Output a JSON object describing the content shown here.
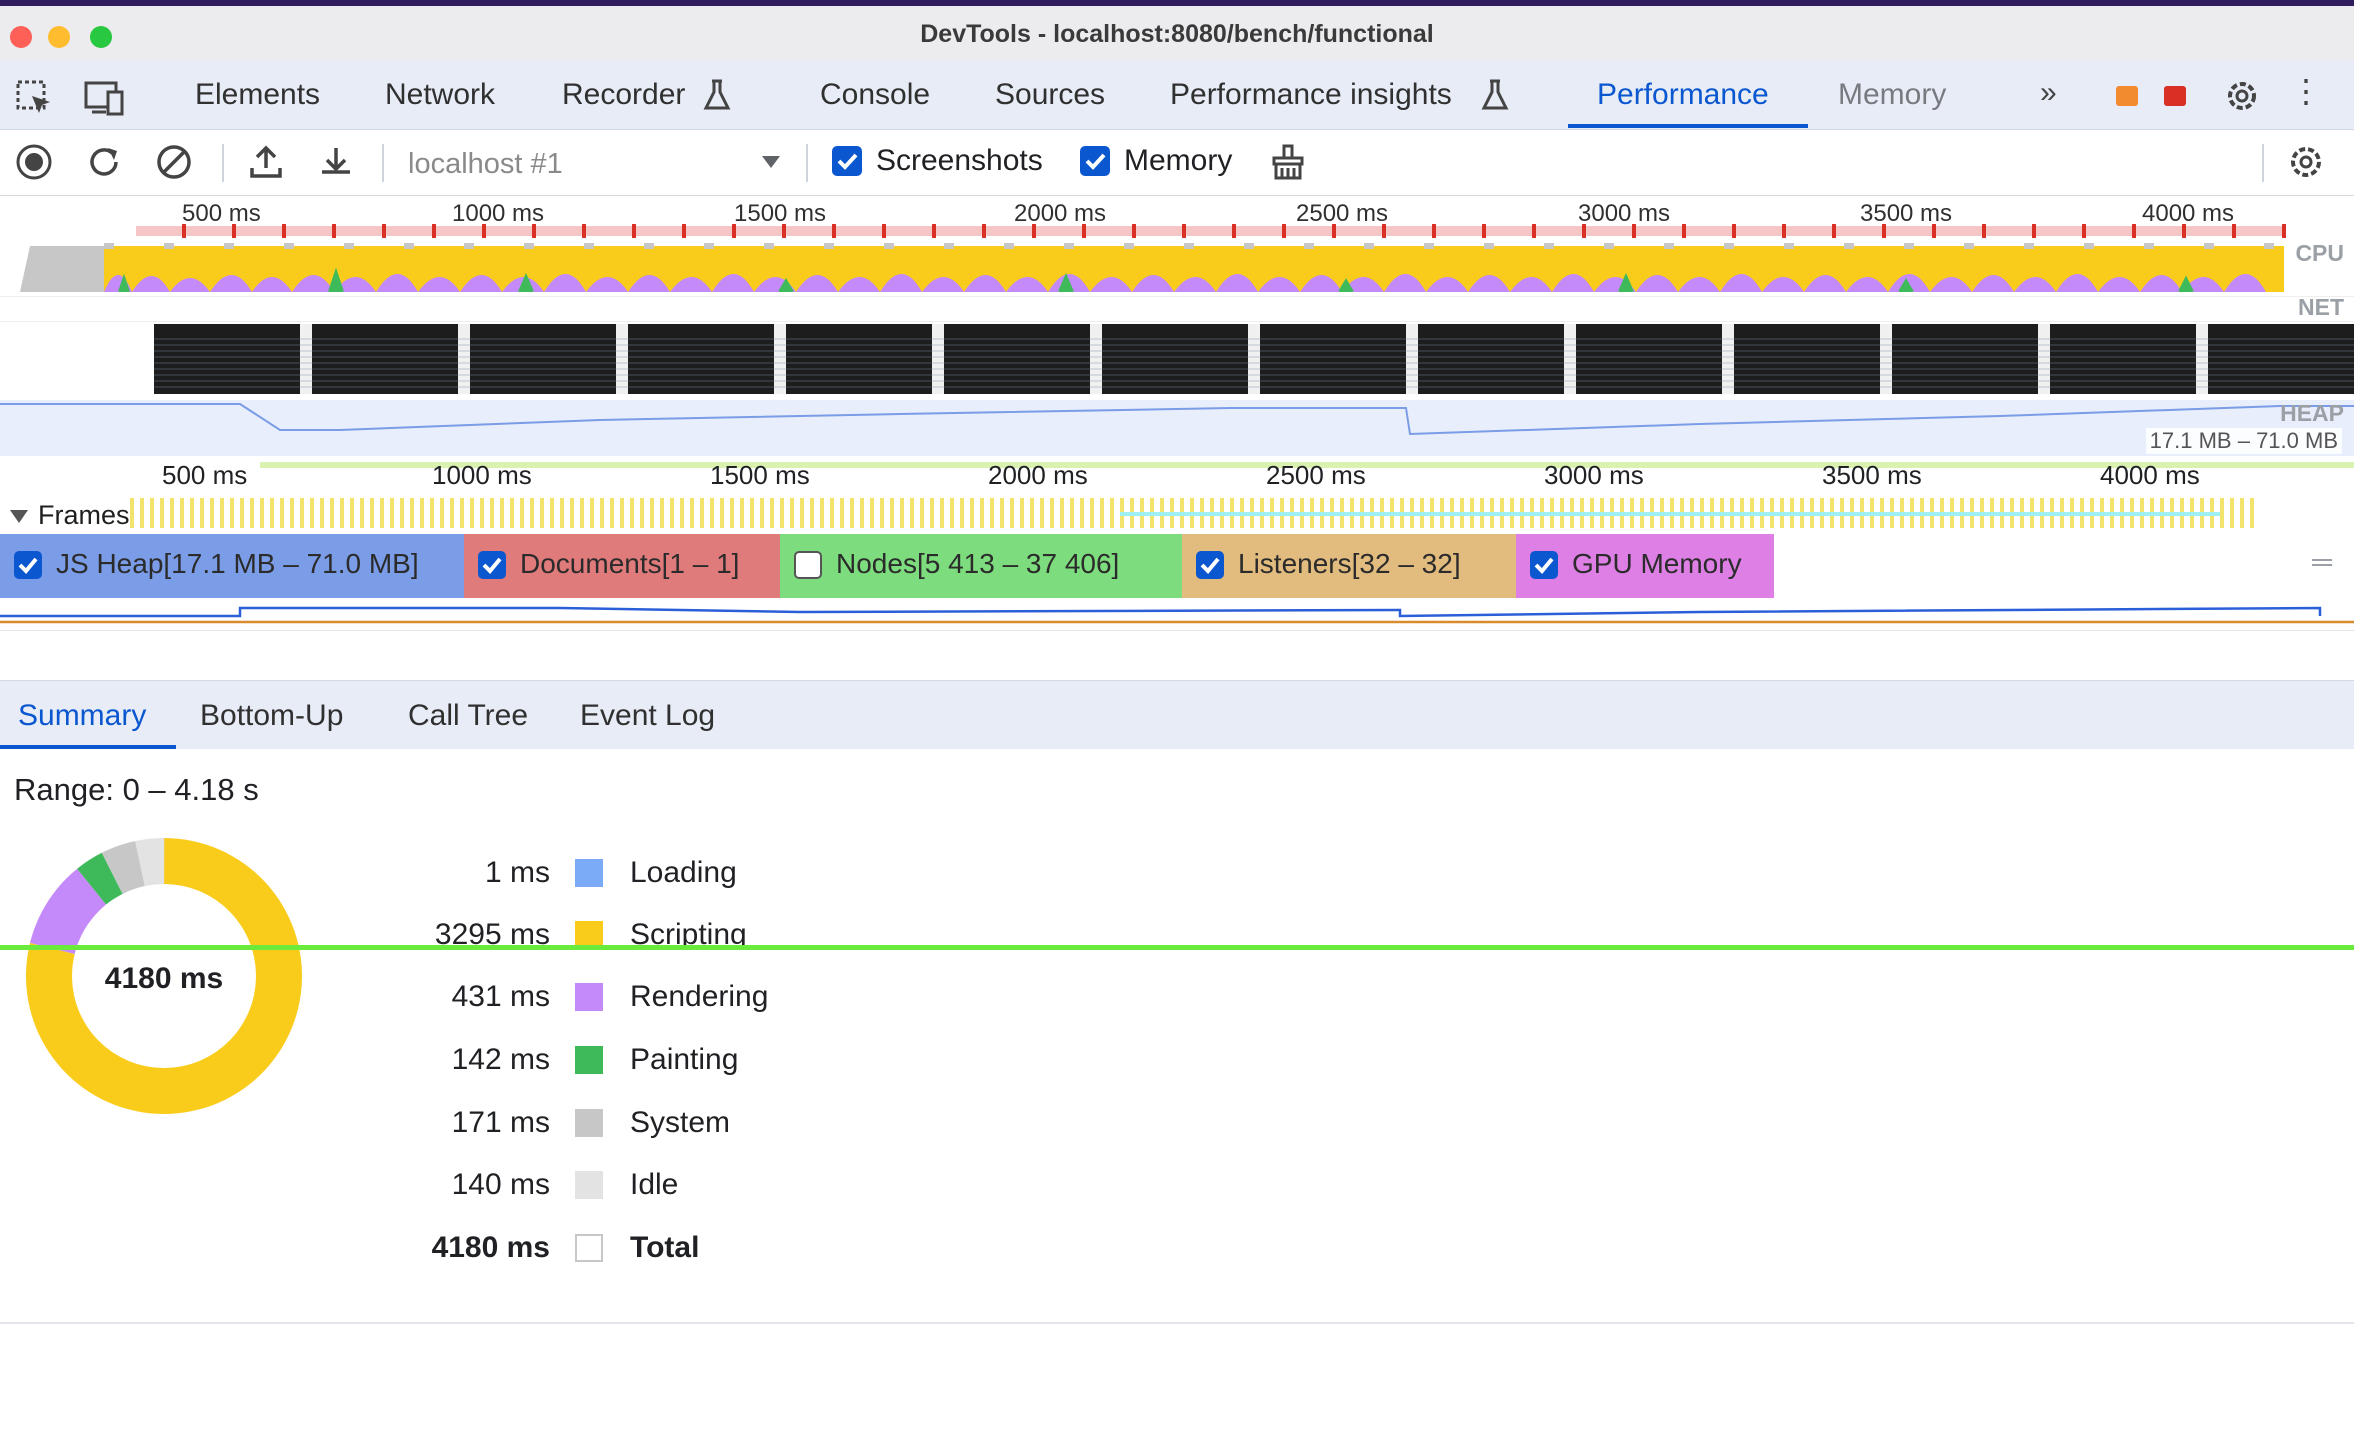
{
  "window": {
    "title": "DevTools - localhost:8080/bench/functional"
  },
  "tabs": [
    {
      "label": "Elements"
    },
    {
      "label": "Network"
    },
    {
      "label": "Recorder"
    },
    {
      "label": "Console"
    },
    {
      "label": "Sources"
    },
    {
      "label": "Performance insights"
    },
    {
      "label": "Performance"
    },
    {
      "label": "Memory"
    }
  ],
  "toolbar": {
    "target": "localhost #1",
    "screenshots_label": "Screenshots",
    "screenshots_checked": true,
    "memory_label": "Memory",
    "memory_checked": true
  },
  "overview": {
    "ruler": [
      "500 ms",
      "1000 ms",
      "1500 ms",
      "2000 ms",
      "2500 ms",
      "3000 ms",
      "3500 ms",
      "4000 ms"
    ],
    "tracks": {
      "cpu": "CPU",
      "net": "NET",
      "heap": "HEAP"
    },
    "heap_range": "17.1 MB – 71.0 MB"
  },
  "timeline": {
    "ruler": [
      "500 ms",
      "1000 ms",
      "1500 ms",
      "2000 ms",
      "2500 ms",
      "3000 ms",
      "3500 ms",
      "4000 ms"
    ],
    "frames_label": "Frames"
  },
  "counters": [
    {
      "label": "JS Heap[17.1 MB – 71.0 MB]",
      "checked": true,
      "color": "#7b9ce6"
    },
    {
      "label": "Documents[1 – 1]",
      "checked": true,
      "color": "#e07b7b"
    },
    {
      "label": "Nodes[5 413 – 37 406]",
      "checked": false,
      "color": "#7ddc7d"
    },
    {
      "label": "Listeners[32 – 32]",
      "checked": true,
      "color": "#e2bb7e"
    },
    {
      "label": "GPU Memory",
      "checked": true,
      "color": "#de7fe5"
    }
  ],
  "details_tabs": [
    {
      "label": "Summary"
    },
    {
      "label": "Bottom-Up"
    },
    {
      "label": "Call Tree"
    },
    {
      "label": "Event Log"
    }
  ],
  "summary": {
    "range": "Range: 0 – 4.18 s",
    "total_center": "4180 ms",
    "items": [
      {
        "value": "1 ms",
        "name": "Loading",
        "ms": 1,
        "color": "#7baaf7"
      },
      {
        "value": "3295 ms",
        "name": "Scripting",
        "ms": 3295,
        "color": "#f9cc1c"
      },
      {
        "value": "431 ms",
        "name": "Rendering",
        "ms": 431,
        "color": "#c58af9"
      },
      {
        "value": "142 ms",
        "name": "Painting",
        "ms": 142,
        "color": "#3fba5a"
      },
      {
        "value": "171 ms",
        "name": "System",
        "ms": 171,
        "color": "#c7c7c7"
      },
      {
        "value": "140 ms",
        "name": "Idle",
        "ms": 140,
        "color": "#e3e3e3"
      },
      {
        "value": "4180 ms",
        "name": "Total",
        "ms": 4180,
        "color": "#ffffff"
      }
    ]
  }
}
